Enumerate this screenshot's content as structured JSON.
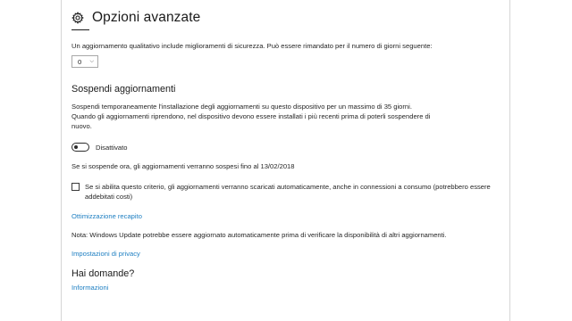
{
  "header": {
    "title": "Opzioni avanzate"
  },
  "quality_update": {
    "description": "Un aggiornamento qualitativo include miglioramenti di sicurezza. Può essere rimandato per il numero di giorni seguente:",
    "days_select_value": "0"
  },
  "pause": {
    "section_title": "Sospendi aggiornamenti",
    "description_line1": "Sospendi temporaneamente l'installazione degli aggiornamenti su questo dispositivo per un massimo di 35 giorni.",
    "description_line2": "Quando gli aggiornamenti riprendono, nel dispositivo devono essere installati i più recenti prima di poterli sospendere di",
    "description_line3": "nuovo.",
    "toggle_label": "Disattivato",
    "toggle_on": false,
    "pause_until_text": "Se si sospende ora, gli aggiornamenti verranno sospesi fino al 13/02/2018"
  },
  "metered": {
    "checkbox_label_line1": "Se si abilita questo criterio, gli aggiornamenti verranno scaricati automaticamente, anche in connessioni a consumo (potrebbero essere",
    "checkbox_label_line2": "addebitati costi)",
    "checked": false
  },
  "links": {
    "delivery_optimization": "Ottimizzazione recapito",
    "privacy_settings": "Impostazioni di privacy",
    "info": "Informazioni"
  },
  "note": "Nota: Windows Update potrebbe essere aggiornato automaticamente prima di verificare la disponibilità di altri aggiornamenti.",
  "questions": {
    "title": "Hai domande?"
  },
  "colors": {
    "link": "#1e7fc2",
    "text": "#262626",
    "border": "#d6d6d6"
  },
  "icons": {
    "header": "gear-icon",
    "select": "chevron-down-icon"
  }
}
